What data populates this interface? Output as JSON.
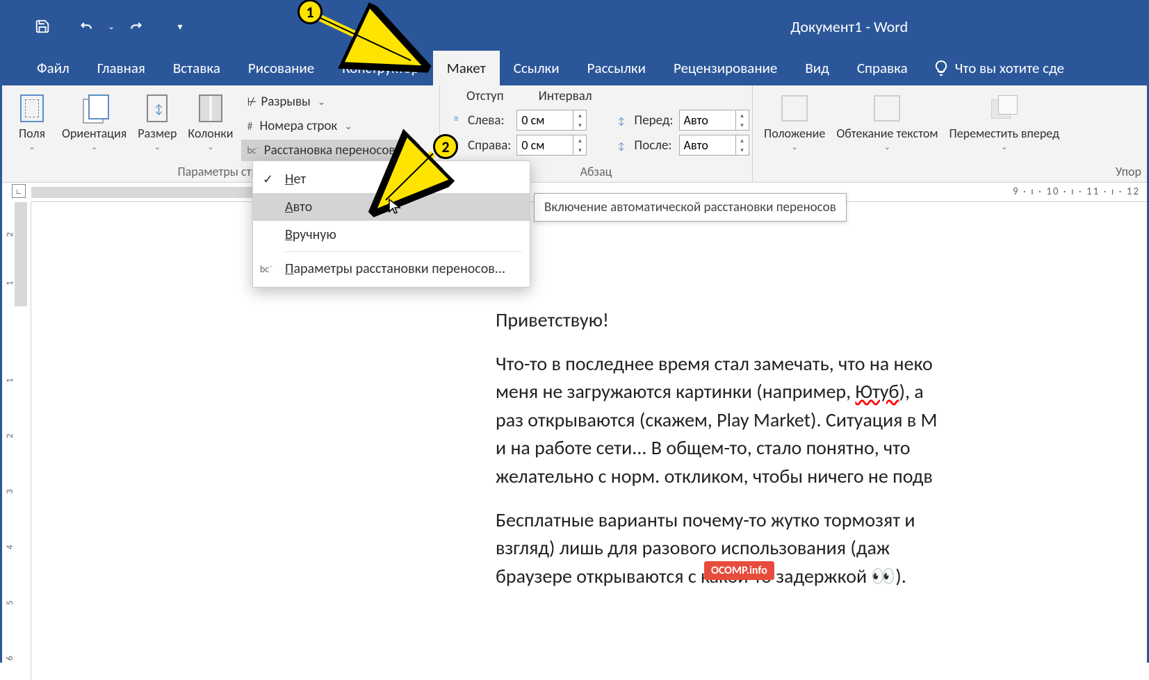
{
  "title": "Документ1  -  Word",
  "tabs": [
    "Файл",
    "Главная",
    "Вставка",
    "Рисование",
    "Конструктор",
    "Макет",
    "Ссылки",
    "Рассылки",
    "Рецензирование",
    "Вид",
    "Справка"
  ],
  "active_tab": 5,
  "tell_me": "Что вы хотите сде",
  "ribbon": {
    "page_setup": {
      "margins": "Поля",
      "orientation": "Ориентация",
      "size": "Размер",
      "columns": "Колонки",
      "breaks": "Разрывы",
      "line_numbers": "Номера строк",
      "hyphenation": "Расстановка переносов",
      "group_label": "Параметры стра"
    },
    "paragraph": {
      "indent_label": "Отступ",
      "spacing_label": "Интервал",
      "left": "Слева:",
      "right": "Справа:",
      "before": "Перед:",
      "after": "После:",
      "left_val": "0 см",
      "right_val": "0 см",
      "before_val": "Авто",
      "after_val": "Авто",
      "group_label": "Абзац"
    },
    "arrange": {
      "position": "Положение",
      "wrap": "Обтекание текстом",
      "bring_forward": "Переместить вперед",
      "group_label": "Упор"
    }
  },
  "dropdown": {
    "none": "Нет",
    "auto": "Авто",
    "manual": "Вручную",
    "options": "Параметры расстановки переносов..."
  },
  "tooltip": "Включение автоматической расстановки переносов",
  "hruler_marks": "9  ·  ı  ·  10  ·  ı  ·  11  ·  ı  ·  12",
  "vruler_marks": [
    "2",
    "1",
    "",
    "1",
    "2",
    "3",
    "4",
    "5",
    "6"
  ],
  "document": {
    "p1": "Приветствую!",
    "p2_a": "Что-то в последнее время стал замечать, что на неко",
    "p2_b": "меня не загружаются картинки (например, ",
    "p2_err": "Ютуб",
    "p2_c": "), а",
    "p2_d": "раз открываются (скажем, Play Market). Ситуация в M",
    "p2_e": "и  на  работе  сети...  В  общем-то,  стало  понятно,  что",
    "p2_f": "желательно с норм. откликом, чтобы ничего не подв",
    "p3_a": "Бесплатные  варианты  почему-то  жутко  тормозят  и",
    "p3_b": "взгляд)   лишь   для   разового   использования   (даж",
    "p3_c": "браузере открываются с какой-то задержкой 👀).",
    "p3_wm": "OCOMP.info"
  },
  "markers": {
    "m1": "1",
    "m2": "2"
  }
}
